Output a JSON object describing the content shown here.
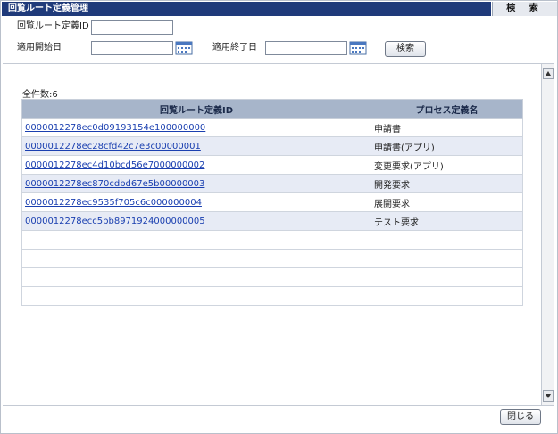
{
  "window": {
    "title": "回覧ルート定義管理",
    "search_tab": "検 索"
  },
  "filters": {
    "route_id_label": "回覧ルート定義ID",
    "route_id_value": "",
    "start_date_label": "適用開始日",
    "start_date_value": "",
    "end_date_label": "適用終了日",
    "end_date_value": "",
    "search_button": "検索"
  },
  "results": {
    "count_text": "全件数:6",
    "columns": [
      "回覧ルート定義ID",
      "プロセス定義名"
    ],
    "rows": [
      {
        "id": "0000012278ec0d09193154e100000000",
        "name": "申請書"
      },
      {
        "id": "0000012278ec28cfd42c7e3c00000001",
        "name": "申請書(アプリ)"
      },
      {
        "id": "0000012278ec4d10bcd56e7000000002",
        "name": "変更要求(アプリ)"
      },
      {
        "id": "0000012278ec870cdbd67e5b00000003",
        "name": "開発要求"
      },
      {
        "id": "0000012278ec9535f705c6c000000004",
        "name": "展開要求"
      },
      {
        "id": "0000012278ecc5bb8971924000000005",
        "name": "テスト要求"
      },
      {
        "id": "",
        "name": ""
      },
      {
        "id": "",
        "name": ""
      },
      {
        "id": "",
        "name": ""
      },
      {
        "id": "",
        "name": ""
      }
    ]
  },
  "footer": {
    "close_button": "閉じる"
  },
  "colors": {
    "title_bar": "#1f3a7a",
    "header_row": "#a7b5ca",
    "alt_row": "#e7ebf5",
    "link": "#1a3fb0"
  },
  "icons": {
    "calendar": "calendar-icon",
    "scroll_up": "arrow-up-icon",
    "scroll_down": "arrow-down-icon"
  }
}
